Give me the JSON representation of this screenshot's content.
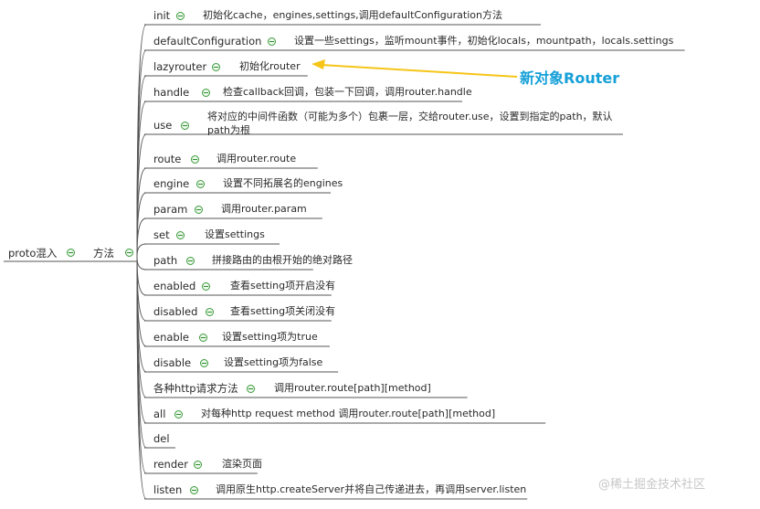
{
  "root": {
    "label": "proto混入"
  },
  "group": {
    "label": "方法"
  },
  "items": [
    {
      "name": "init",
      "desc": "初始化cache，engines,settings,调用defaultConfiguration方法"
    },
    {
      "name": "defaultConfiguration",
      "desc": "设置一些settings，监听mount事件，初始化locals，mountpath，locals.settings"
    },
    {
      "name": "lazyrouter",
      "desc": "初始化router"
    },
    {
      "name": "handle",
      "desc": "检查callback回调，包装一下回调，调用router.handle"
    },
    {
      "name": "use",
      "desc": "将对应的中间件函数（可能为多个）包裹一层，交给router.use，设置到指定的path，默认path为根"
    },
    {
      "name": "route",
      "desc": "调用router.route"
    },
    {
      "name": "engine",
      "desc": "设置不同拓展名的engines"
    },
    {
      "name": "param",
      "desc": "调用router.param"
    },
    {
      "name": "set",
      "desc": "设置settings"
    },
    {
      "name": "path",
      "desc": "拼接路由的由根开始的绝对路径"
    },
    {
      "name": "enabled",
      "desc": "查看setting项开启没有"
    },
    {
      "name": "disabled",
      "desc": "查看setting项关闭没有"
    },
    {
      "name": "enable",
      "desc": "设置setting项为true"
    },
    {
      "name": "disable",
      "desc": "设置setting项为false"
    },
    {
      "name": "各种http请求方法",
      "desc": "调用router.route[path][method]"
    },
    {
      "name": "all",
      "desc": "对每种http request method 调用router.route[path][method]"
    },
    {
      "name": "del",
      "desc": ""
    },
    {
      "name": "render",
      "desc": "渲染页面"
    },
    {
      "name": "listen",
      "desc": "调用原生http.createServer并将自己传递进去，再调用server.listen"
    }
  ],
  "callout": {
    "text": "新对象Router",
    "target": "lazyrouter",
    "color": "#16a0d8",
    "arrow_color": "#f5c518"
  },
  "watermark": {
    "text": "@稀土掘金技术社区"
  },
  "colors": {
    "line": "#555555",
    "collapse_border": "#3a9a3a"
  },
  "icons": {
    "collapse": "collapse-minus-icon",
    "arrow": "arrow-left-icon"
  }
}
